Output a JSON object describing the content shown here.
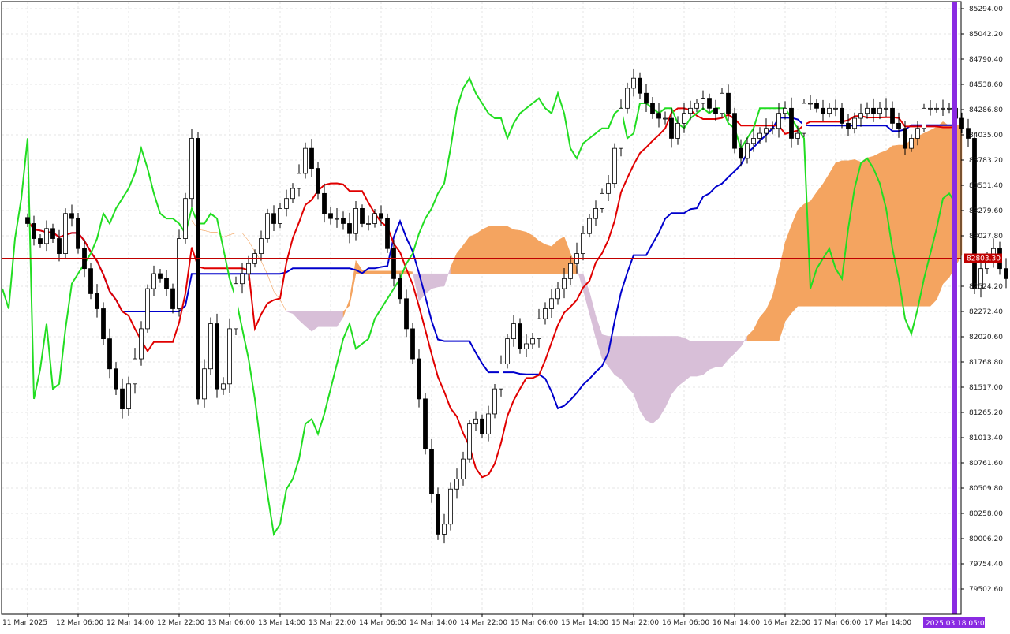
{
  "chart_data": {
    "type": "candlestick",
    "y_ticks": [
      "85294.00",
      "85042.20",
      "84790.40",
      "84538.60",
      "84286.80",
      "84035.00",
      "83783.20",
      "83531.40",
      "83279.60",
      "83027.80",
      "82524.20",
      "82272.40",
      "82020.60",
      "81768.80",
      "81517.00",
      "81265.20",
      "81013.40",
      "80761.60",
      "80509.80",
      "80258.00",
      "80006.20",
      "79754.40",
      "79502.60"
    ],
    "y_tick_values": [
      85294.0,
      85042.2,
      84790.4,
      84538.6,
      84286.8,
      84035.0,
      83783.2,
      83531.4,
      83279.6,
      83027.8,
      82524.2,
      82272.4,
      82020.6,
      81768.8,
      81517.0,
      81265.2,
      81013.4,
      80761.6,
      80509.8,
      80258.0,
      80006.2,
      79754.4,
      79502.6
    ],
    "ylim": [
      79376.7,
      85420
    ],
    "x_ticks": [
      "11 Mar 2025",
      "12 Mar 06:00",
      "12 Mar 14:00",
      "12 Mar 22:00",
      "13 Mar 06:00",
      "13 Mar 14:00",
      "13 Mar 22:00",
      "14 Mar 06:00",
      "14 Mar 14:00",
      "14 Mar 22:00",
      "15 Mar 06:00",
      "15 Mar 14:00",
      "15 Mar 22:00",
      "16 Mar 06:00",
      "16 Mar 14:00",
      "16 Mar 22:00",
      "17 Mar 06:00",
      "17 Mar 14:00"
    ],
    "current_price": "82803.30",
    "current_price_value": 82803.3,
    "current_time": "2025.03.18 05:00",
    "bars_per_tick": 8,
    "closes": [
      83150,
      83000,
      82950,
      83100,
      83000,
      82850,
      83250,
      83200,
      82900,
      82700,
      82450,
      82300,
      82000,
      81700,
      81500,
      81300,
      81550,
      81800,
      82100,
      82500,
      82650,
      82600,
      82500,
      82300,
      83000,
      83400,
      84000,
      81400,
      81700,
      82150,
      81500,
      81550,
      82100,
      82550,
      82650,
      82750,
      82850,
      83000,
      83250,
      83150,
      83300,
      83400,
      83500,
      83650,
      83900,
      83700,
      83450,
      83250,
      83200,
      83200,
      83150,
      83050,
      83300,
      83150,
      83150,
      83250,
      83200,
      82900,
      82600,
      82400,
      82100,
      81800,
      81400,
      80900,
      80450,
      80050,
      80150,
      80500,
      80600,
      80800,
      81150,
      81200,
      81050,
      81250,
      81500,
      81750,
      82000,
      82150,
      81900,
      81950,
      82000,
      82200,
      82300,
      82400,
      82500,
      82600,
      82750,
      82850,
      83050,
      83200,
      83300,
      83450,
      83550,
      83900,
      84300,
      84500,
      84600,
      84450,
      84350,
      84250,
      84200,
      84200,
      84000,
      84150,
      84250,
      84300,
      84350,
      84400,
      84300,
      84250,
      84450,
      84250,
      83900,
      83800,
      83950,
      84000,
      84050,
      84100,
      84100,
      84250,
      84300,
      84000,
      84050,
      84350,
      84350,
      84300,
      84250,
      84300,
      84300,
      84150,
      84100,
      84200,
      84250,
      84300,
      84250,
      84300,
      84300,
      84150,
      84100,
      83900,
      84000,
      84100,
      84300,
      84300,
      84300,
      84300,
      84300,
      84200,
      84100,
      84000,
      82500,
      82700,
      82800,
      82900,
      82700,
      82600,
      83100,
      83500,
      83750,
      83800,
      83700,
      83550,
      83300,
      82900,
      82600,
      82200,
      82050,
      82300,
      82600,
      82850,
      83100,
      83400,
      83450,
      83350,
      83200,
      83300,
      83550,
      83450,
      83300,
      83250,
      83150,
      83200,
      83300,
      83250,
      83200,
      83000,
      82800
    ]
  },
  "colors": {
    "bull_candle": "#ffffff",
    "bear_candle": "#000000",
    "highlight_candle": "#1a5ea8",
    "tenkan": "#e00000",
    "kijun": "#0000cc",
    "chikou": "#22dd22",
    "kumo_up": "#f4a460",
    "kumo_down": "#d8bfd8",
    "price_line": "#c00000",
    "price_label_bg": "#c00000",
    "time_marker": "#8a2be2",
    "highlight_box": "#ff44cc",
    "arrow": "#33cc33"
  },
  "icons": {
    "arrow": "up-arrow-icon"
  }
}
